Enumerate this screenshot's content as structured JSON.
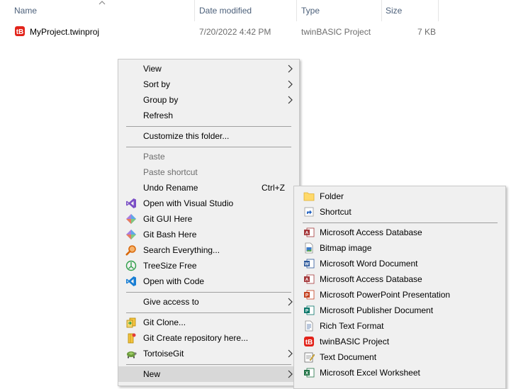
{
  "columns": {
    "name": "Name",
    "date": "Date modified",
    "type": "Type",
    "size": "Size"
  },
  "file": {
    "name": "MyProject.twinproj",
    "date": "7/20/2022 4:42 PM",
    "type": "twinBASIC Project",
    "size": "7 KB"
  },
  "menu": {
    "view": "View",
    "sort_by": "Sort by",
    "group_by": "Group by",
    "refresh": "Refresh",
    "customize": "Customize this folder...",
    "paste": "Paste",
    "paste_shortcut": "Paste shortcut",
    "undo_rename": "Undo Rename",
    "undo_shortcut": "Ctrl+Z",
    "open_vs": "Open with Visual Studio",
    "git_gui": "Git GUI Here",
    "git_bash": "Git Bash Here",
    "search_everything": "Search Everything...",
    "treesize": "TreeSize Free",
    "open_code": "Open with Code",
    "give_access": "Give access to",
    "git_clone": "Git Clone...",
    "git_create": "Git Create repository here...",
    "tortoisegit": "TortoiseGit",
    "new": "New"
  },
  "submenu": {
    "folder": "Folder",
    "shortcut": "Shortcut",
    "access_db_1": "Microsoft Access Database",
    "bitmap": "Bitmap image",
    "word": "Microsoft Word Document",
    "access_db_2": "Microsoft Access Database",
    "powerpoint": "Microsoft PowerPoint Presentation",
    "publisher": "Microsoft Publisher Document",
    "rtf": "Rich Text Format",
    "twinbasic": "twinBASIC Project",
    "text": "Text Document",
    "excel": "Microsoft Excel Worksheet"
  }
}
